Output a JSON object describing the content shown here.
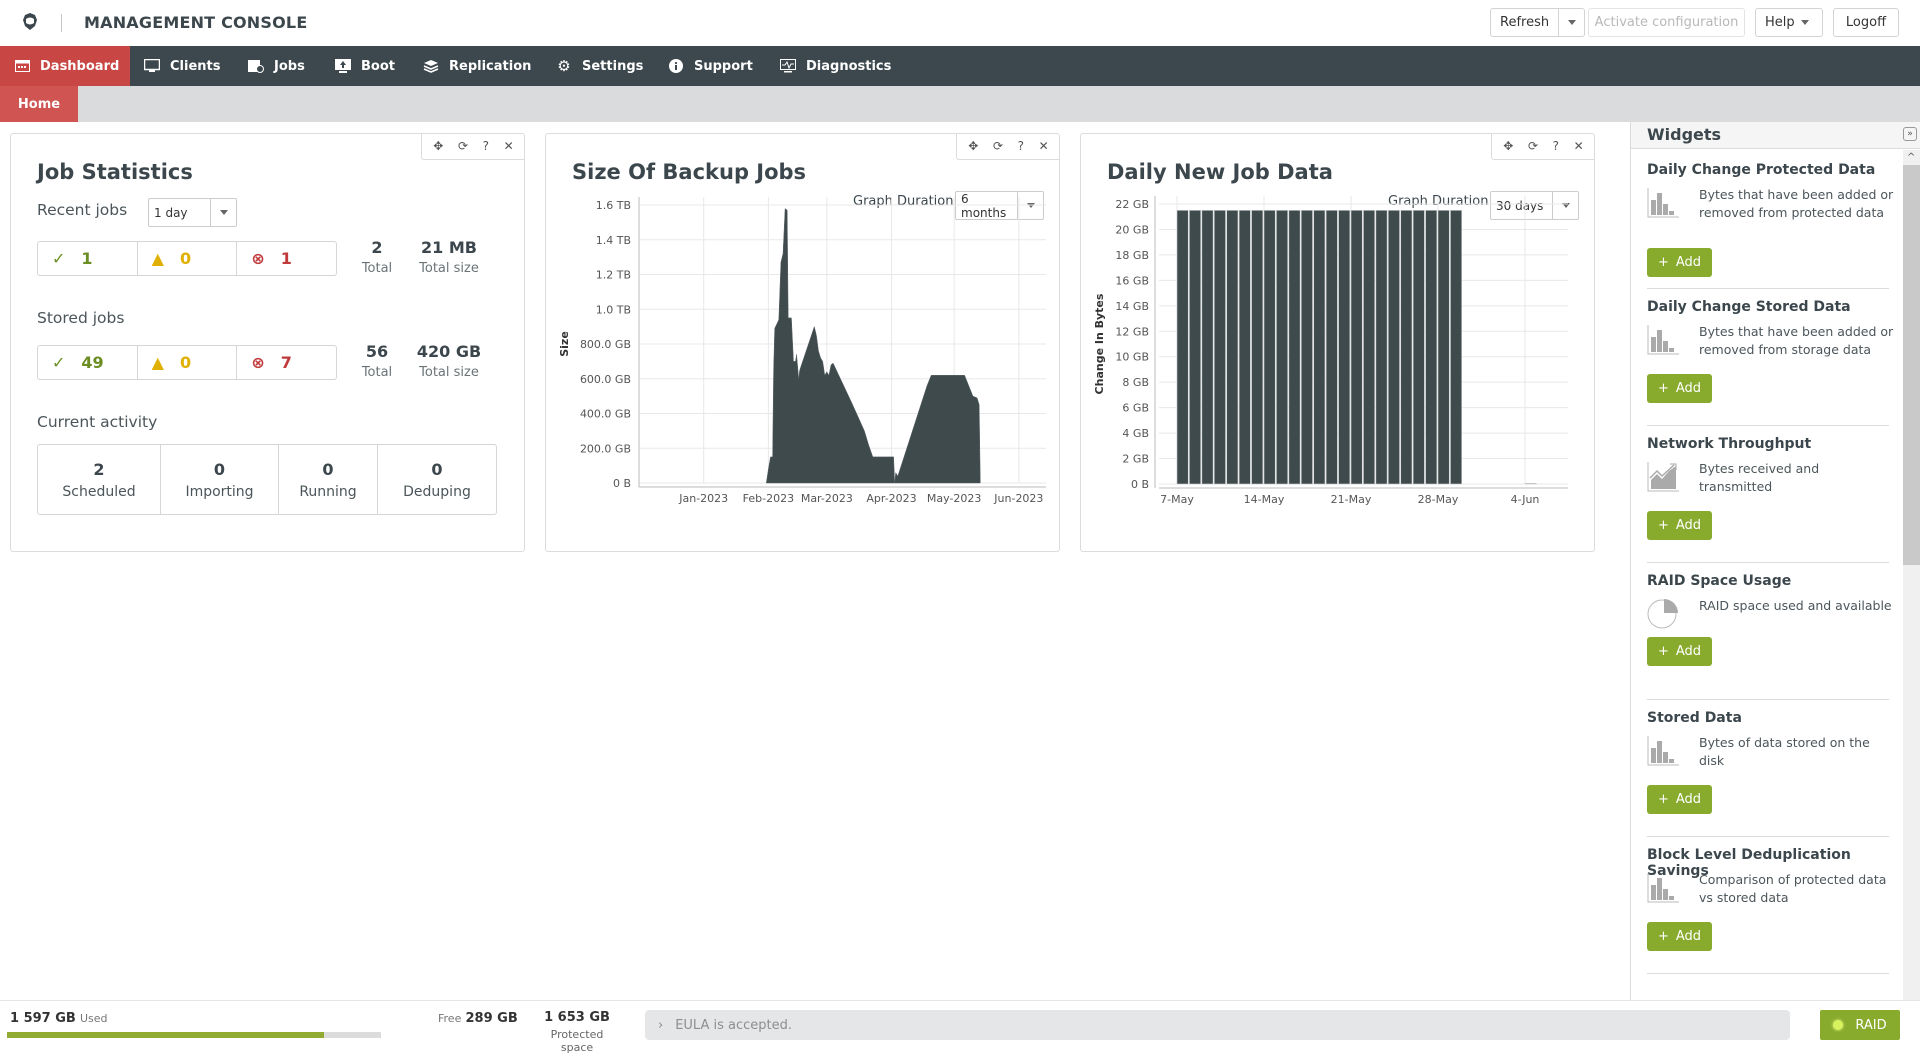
{
  "header": {
    "title": "MANAGEMENT CONSOLE",
    "refresh_label": "Refresh",
    "activate_label": "Activate configuration",
    "help_label": "Help",
    "logoff_label": "Logoff"
  },
  "nav": {
    "items": [
      {
        "label": "Dashboard",
        "icon": "dashboard-icon",
        "active": true
      },
      {
        "label": "Clients",
        "icon": "monitor-icon"
      },
      {
        "label": "Jobs",
        "icon": "jobs-icon"
      },
      {
        "label": "Boot",
        "icon": "boot-icon"
      },
      {
        "label": "Replication",
        "icon": "layers-icon"
      },
      {
        "label": "Settings",
        "icon": "gear-icon"
      },
      {
        "label": "Support",
        "icon": "info-icon"
      },
      {
        "label": "Diagnostics",
        "icon": "diagnostics-icon"
      }
    ]
  },
  "subnav": {
    "home_label": "Home"
  },
  "job_stats": {
    "title": "Job Statistics",
    "recent_label": "Recent jobs",
    "recent_period": "1 day",
    "recent": {
      "ok": "1",
      "warn": "0",
      "err": "1",
      "total": "2",
      "total_label": "Total",
      "size": "21 MB",
      "size_label": "Total size"
    },
    "stored_label": "Stored jobs",
    "stored": {
      "ok": "49",
      "warn": "0",
      "err": "7",
      "total": "56",
      "total_label": "Total",
      "size": "420 GB",
      "size_label": "Total size"
    },
    "activity_label": "Current activity",
    "activity": [
      {
        "value": "2",
        "label": "Scheduled"
      },
      {
        "value": "0",
        "label": "Importing"
      },
      {
        "value": "0",
        "label": "Running"
      },
      {
        "value": "0",
        "label": "Deduping"
      }
    ]
  },
  "backup_size": {
    "title": "Size Of Backup Jobs",
    "duration_label": "Graph Duration:",
    "duration_value": "6 months"
  },
  "daily_new": {
    "title": "Daily New Job Data",
    "duration_label": "Graph Duration:",
    "duration_value": "30 days"
  },
  "chart_data": [
    {
      "type": "area",
      "title": "Size Of Backup Jobs",
      "xlabel": "",
      "ylabel": "Size",
      "x_ticks": [
        "Jan-2023",
        "Feb-2023",
        "Mar-2023",
        "Apr-2023",
        "May-2023",
        "Jun-2023"
      ],
      "y_ticks": [
        "0 B",
        "200.0 GB",
        "400.0 GB",
        "600.0 GB",
        "800.0 GB",
        "1.0 TB",
        "1.2 TB",
        "1.4 TB",
        "1.6 TB"
      ],
      "ylim_gb": [
        0,
        1600
      ],
      "grid": true,
      "x_unit": "days since 2022-12-01",
      "points": [
        [
          49,
          0
        ],
        [
          50,
          80
        ],
        [
          51,
          150
        ],
        [
          52,
          150
        ],
        [
          52.5,
          650
        ],
        [
          53,
          890
        ],
        [
          55,
          940
        ],
        [
          56,
          1270
        ],
        [
          57,
          1320
        ],
        [
          58,
          1580
        ],
        [
          59,
          1570
        ],
        [
          59.5,
          950
        ],
        [
          61,
          950
        ],
        [
          62,
          700
        ],
        [
          63,
          700
        ],
        [
          63.5,
          740
        ],
        [
          64.5,
          600
        ],
        [
          65,
          650
        ],
        [
          72,
          900
        ],
        [
          73,
          850
        ],
        [
          74,
          760
        ],
        [
          75,
          720
        ],
        [
          76,
          700
        ],
        [
          77,
          620
        ],
        [
          78,
          640
        ],
        [
          79,
          620
        ],
        [
          80,
          680
        ],
        [
          81,
          690
        ],
        [
          90,
          460
        ],
        [
          96,
          300
        ],
        [
          98,
          220
        ],
        [
          100,
          150
        ],
        [
          110,
          150
        ],
        [
          110.5,
          0
        ],
        [
          111,
          60
        ],
        [
          112,
          40
        ],
        [
          126,
          560
        ],
        [
          128,
          620
        ],
        [
          144,
          620
        ],
        [
          148,
          500
        ],
        [
          150,
          490
        ],
        [
          151,
          450
        ],
        [
          151.5,
          0
        ]
      ]
    },
    {
      "type": "bar",
      "title": "Daily New Job Data",
      "xlabel": "",
      "ylabel": "Change In Bytes",
      "x_ticks": [
        "7-May",
        "14-May",
        "21-May",
        "28-May",
        "4-Jun"
      ],
      "y_ticks": [
        "0 B",
        "2 GB",
        "4 GB",
        "6 GB",
        "8 GB",
        "10 GB",
        "12 GB",
        "14 GB",
        "16 GB",
        "18 GB",
        "20 GB",
        "22 GB"
      ],
      "ylim_gb": [
        0,
        22
      ],
      "grid": true,
      "categories": [
        "7-May",
        "8-May",
        "9-May",
        "10-May",
        "11-May",
        "12-May",
        "13-May",
        "14-May",
        "15-May",
        "16-May",
        "17-May",
        "18-May",
        "19-May",
        "20-May",
        "21-May",
        "22-May",
        "23-May",
        "24-May",
        "25-May",
        "26-May",
        "27-May",
        "28-May",
        "29-May",
        "30-May",
        "31-May",
        "1-Jun",
        "2-Jun",
        "3-Jun",
        "4-Jun",
        "5-Jun"
      ],
      "values": [
        21.5,
        21.5,
        21.5,
        21.5,
        21.5,
        21.5,
        21.5,
        21.5,
        21.5,
        21.5,
        21.5,
        21.5,
        21.5,
        21.5,
        21.5,
        21.5,
        21.5,
        21.5,
        21.5,
        21.5,
        21.5,
        21.5,
        21.5,
        0,
        0,
        0,
        0,
        0,
        0.05,
        0
      ]
    }
  ],
  "widgets": {
    "title": "Widgets",
    "add_label": "Add",
    "items": [
      {
        "name": "Daily Change Protected Data",
        "desc": "Bytes that have been added or removed from protected data",
        "icon": "bar-chart-icon"
      },
      {
        "name": "Daily Change Stored Data",
        "desc": "Bytes that have been added or removed from storage data",
        "icon": "bar-chart-icon"
      },
      {
        "name": "Network Throughput",
        "desc": "Bytes received and transmitted",
        "icon": "trend-chart-icon"
      },
      {
        "name": "RAID Space Usage",
        "desc": "RAID space used and available",
        "icon": "pie-chart-icon"
      },
      {
        "name": "Stored Data",
        "desc": "Bytes of data stored on the disk",
        "icon": "bar-chart-icon"
      },
      {
        "name": "Block Level Deduplication Savings",
        "desc": "Comparison of protected data vs stored data",
        "icon": "bar-chart-icon"
      }
    ]
  },
  "footer": {
    "used_value": "1 597 GB",
    "used_label": "Used",
    "free_label": "Free",
    "free_value": "289 GB",
    "used_fraction": 0.847,
    "protected_value": "1 653 GB",
    "protected_label": "Protected space",
    "eula_text": "EULA is accepted.",
    "raid_label": "RAID",
    "raid_status_color": "#d7f25e"
  },
  "colors": {
    "nav_bg": "#3c484d",
    "accent_red": "#c84644",
    "add_green": "#88aa2d",
    "chart_fill": "#3f4a4d"
  }
}
